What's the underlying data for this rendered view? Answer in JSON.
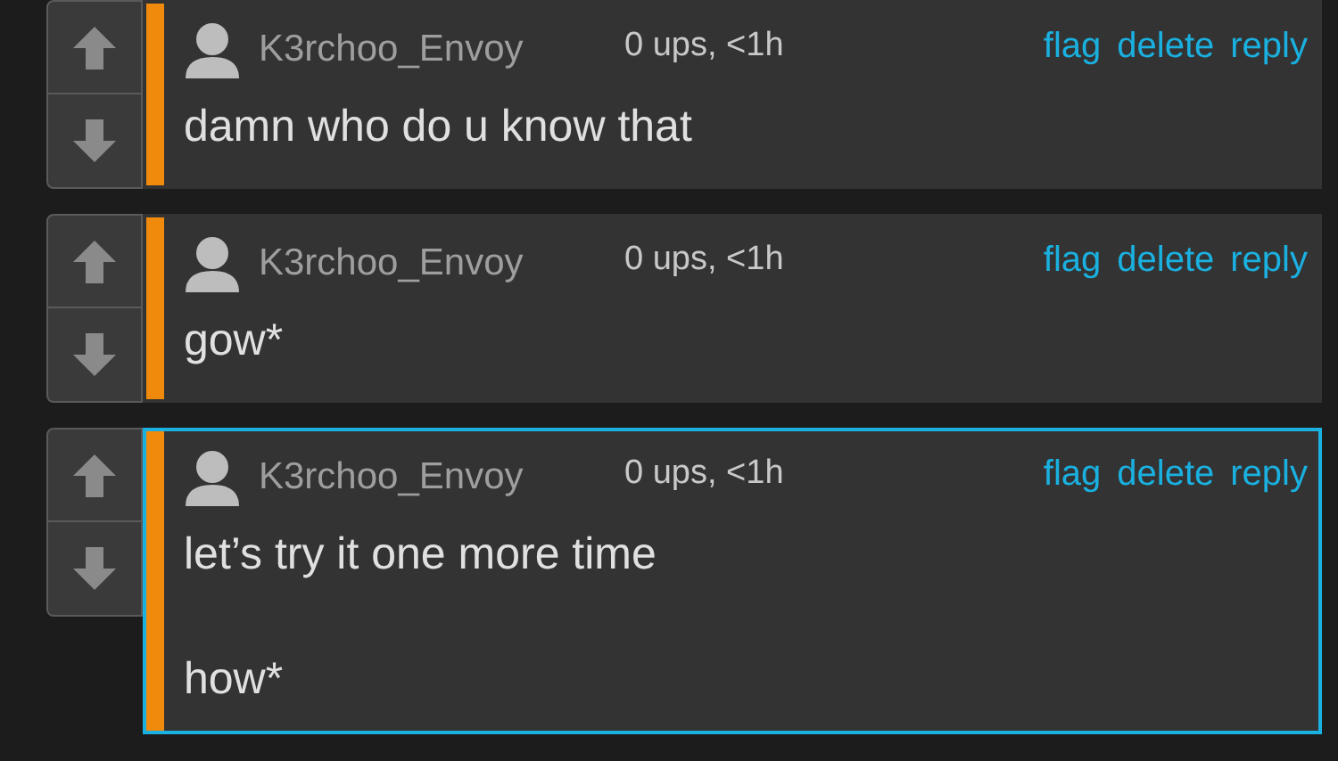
{
  "comments": [
    {
      "username": "K3rchoo_Envoy",
      "meta": "0 ups, <1h",
      "actions": [
        "flag",
        "delete",
        "reply"
      ],
      "body": [
        "damn who do u know that"
      ],
      "highlighted": false
    },
    {
      "username": "K3rchoo_Envoy",
      "meta": "0 ups, <1h",
      "actions": [
        "flag",
        "delete",
        "reply"
      ],
      "body": [
        "gow*"
      ],
      "highlighted": false
    },
    {
      "username": "K3rchoo_Envoy",
      "meta": "0 ups, <1h",
      "actions": [
        "flag",
        "delete",
        "reply"
      ],
      "body": [
        "let’s try it one more time",
        "how*"
      ],
      "highlighted": true
    }
  ]
}
